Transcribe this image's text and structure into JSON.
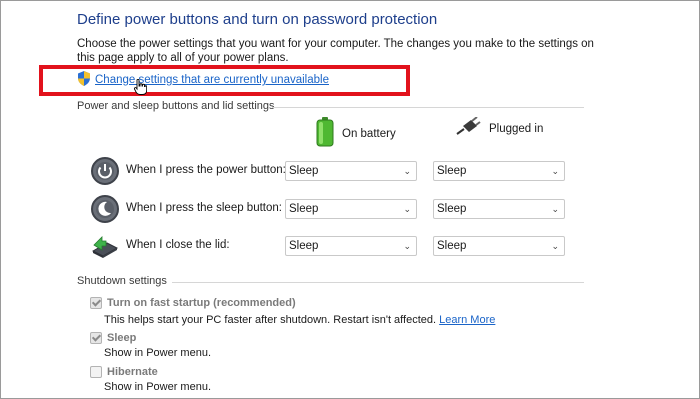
{
  "page": {
    "title": "Define power buttons and turn on password protection",
    "description": "Choose the power settings that you want for your computer. The changes you make to the settings on this page apply to all of your power plans.",
    "change_link": "Change settings that are currently unavailable"
  },
  "power_section": {
    "heading": "Power and sleep buttons and lid settings",
    "col_battery": "On battery",
    "col_plugged": "Plugged in",
    "rows": [
      {
        "label": "When I press the power button:",
        "battery": "Sleep",
        "plugged": "Sleep"
      },
      {
        "label": "When I press the sleep button:",
        "battery": "Sleep",
        "plugged": "Sleep"
      },
      {
        "label": "When I close the lid:",
        "battery": "Sleep",
        "plugged": "Sleep"
      }
    ]
  },
  "shutdown": {
    "heading": "Shutdown settings",
    "items": [
      {
        "label": "Turn on fast startup (recommended)",
        "desc": "This helps start your PC faster after shutdown. Restart isn't affected.",
        "link": "Learn More",
        "checked": true
      },
      {
        "label": "Sleep",
        "desc": "Show in Power menu.",
        "checked": true
      },
      {
        "label": "Hibernate",
        "desc": "Show in Power menu.",
        "checked": false
      }
    ]
  },
  "colors": {
    "title": "#1e3f8c",
    "link": "#1a64c8",
    "highlight": "#e2121c"
  }
}
